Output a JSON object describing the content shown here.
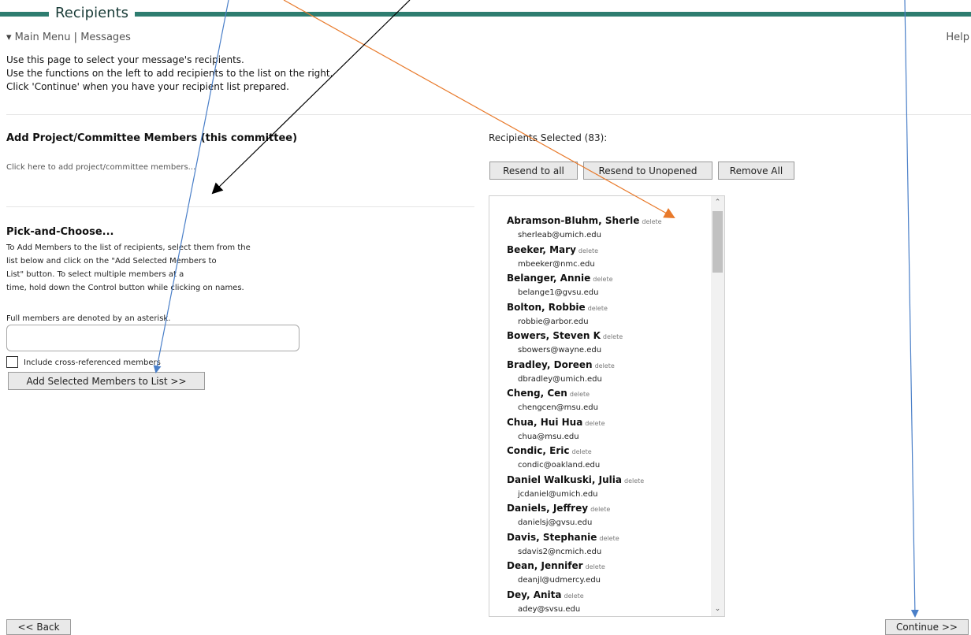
{
  "header": {
    "title": "Recipients"
  },
  "breadcrumb": {
    "marker": "▾",
    "main_menu": "Main Menu",
    "separator": " | ",
    "messages": "Messages"
  },
  "help": "Help",
  "intro": [
    "Use this page to select your message's recipients.",
    "Use the functions on the left to add recipients to the list on the right.",
    "Click 'Continue' when you have your recipient list prepared."
  ],
  "add_members": {
    "title": "Add Project/Committee Members (this committee)",
    "link": "Click here to add project/committee members..."
  },
  "pick": {
    "title": "Pick-and-Choose...",
    "desc_lines": [
      "To Add Members to the list of recipients, select them from the",
      "list below and click on the \"Add Selected Members to",
      "List\" button.  To select multiple members at a",
      "time, hold down the Control button while clicking on names."
    ],
    "full_note": "Full members are denoted by an asterisk.",
    "include_label": "Include cross-referenced members",
    "add_button": "Add Selected Members to List >>"
  },
  "recipients": {
    "label": "Recipients Selected (83):",
    "resend_all": "Resend to all",
    "resend_unopened": "Resend to Unopened",
    "remove_all": "Remove All",
    "delete_label": "delete",
    "list": [
      {
        "name": "Abramson-Bluhm, Sherle",
        "email": "sherleab@umich.edu"
      },
      {
        "name": "Beeker, Mary",
        "email": "mbeeker@nmc.edu"
      },
      {
        "name": "Belanger, Annie",
        "email": "belange1@gvsu.edu"
      },
      {
        "name": "Bolton, Robbie",
        "email": "robbie@arbor.edu"
      },
      {
        "name": "Bowers, Steven K",
        "email": "sbowers@wayne.edu"
      },
      {
        "name": "Bradley, Doreen",
        "email": "dbradley@umich.edu"
      },
      {
        "name": "Cheng, Cen",
        "email": "chengcen@msu.edu"
      },
      {
        "name": "Chua, Hui Hua",
        "email": "chua@msu.edu"
      },
      {
        "name": "Condic, Eric",
        "email": "condic@oakland.edu"
      },
      {
        "name": "Daniel Walkuski, Julia",
        "email": "jcdaniel@umich.edu"
      },
      {
        "name": "Daniels, Jeffrey",
        "email": "danielsj@gvsu.edu"
      },
      {
        "name": "Davis, Stephanie",
        "email": "sdavis2@ncmich.edu"
      },
      {
        "name": "Dean, Jennifer",
        "email": "deanjl@udmercy.edu"
      },
      {
        "name": "Dey, Anita",
        "email": "adey@svsu.edu"
      }
    ]
  },
  "footer": {
    "back": "<< Back",
    "continue": "Continue >>"
  },
  "colors": {
    "accent": "#2e7d70",
    "arrow_blue": "#4a7fc8",
    "arrow_orange": "#e8792a",
    "arrow_black": "#000000"
  }
}
